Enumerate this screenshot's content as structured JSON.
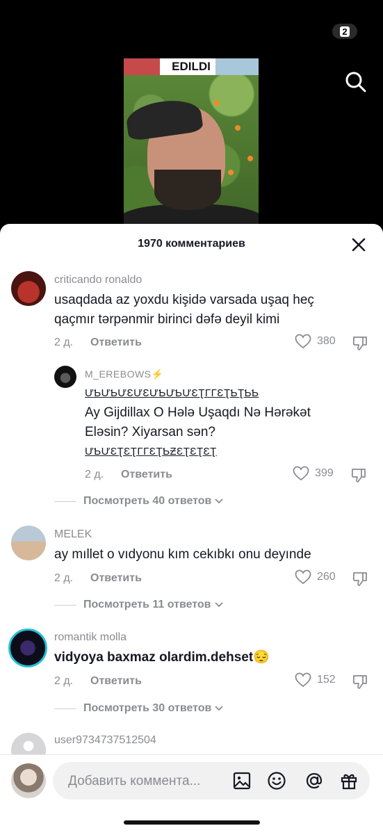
{
  "status": {
    "badge": "2"
  },
  "video": {
    "banner": "EDILDI"
  },
  "comments_header": {
    "title": "1970 комментариев"
  },
  "comments": [
    {
      "username": "criticando ronaldo",
      "text": "usaqdada az yoxdu kişidə varsada uşaq heç qaçmır tərpənmir birinci dəfə deyil kimi",
      "time": "2 д.",
      "reply_label": "Ответить",
      "likes": "380"
    },
    {
      "username": "M_EREBOWS⚡",
      "text_lines": [
        "ƯƄƯƄƯƐƯƐƯƄƯƄƯƐƮΓΓƐƮƄƮƄƄ",
        "Ay Gijdillax O Hələ Uşaqdı Nə Hərəkət",
        "Eləsin? Xiyarsan sən?",
        "ƯƄƯƐƮƐƮΓΓƐƮƄƵƐƮƐƮƐƮ"
      ],
      "time": "2 д.",
      "reply_label": "Ответить",
      "likes": "399"
    },
    {
      "username": "MELEK",
      "text": "ay mıllet o vıdyonu kım cekıbkı onu deyınde",
      "time": "2 д.",
      "reply_label": "Ответить",
      "likes": "260"
    },
    {
      "username": "romantik molla",
      "text": "vidyoya baxmaz olardim.dehset😔",
      "time": "2 д.",
      "reply_label": "Ответить",
      "likes": "152"
    },
    {
      "username": "user9734737512504"
    }
  ],
  "view_replies": [
    "Посмотреть 40 ответов",
    "Посмотреть 11 ответов",
    "Посмотреть 30 ответов"
  ],
  "input": {
    "placeholder": "Добавить коммента..."
  },
  "icons": [
    "search-icon",
    "close-icon",
    "heart-icon",
    "dislike-icon",
    "chevron-down-icon",
    "image-icon",
    "emoji-icon",
    "mention-icon",
    "gift-icon"
  ]
}
